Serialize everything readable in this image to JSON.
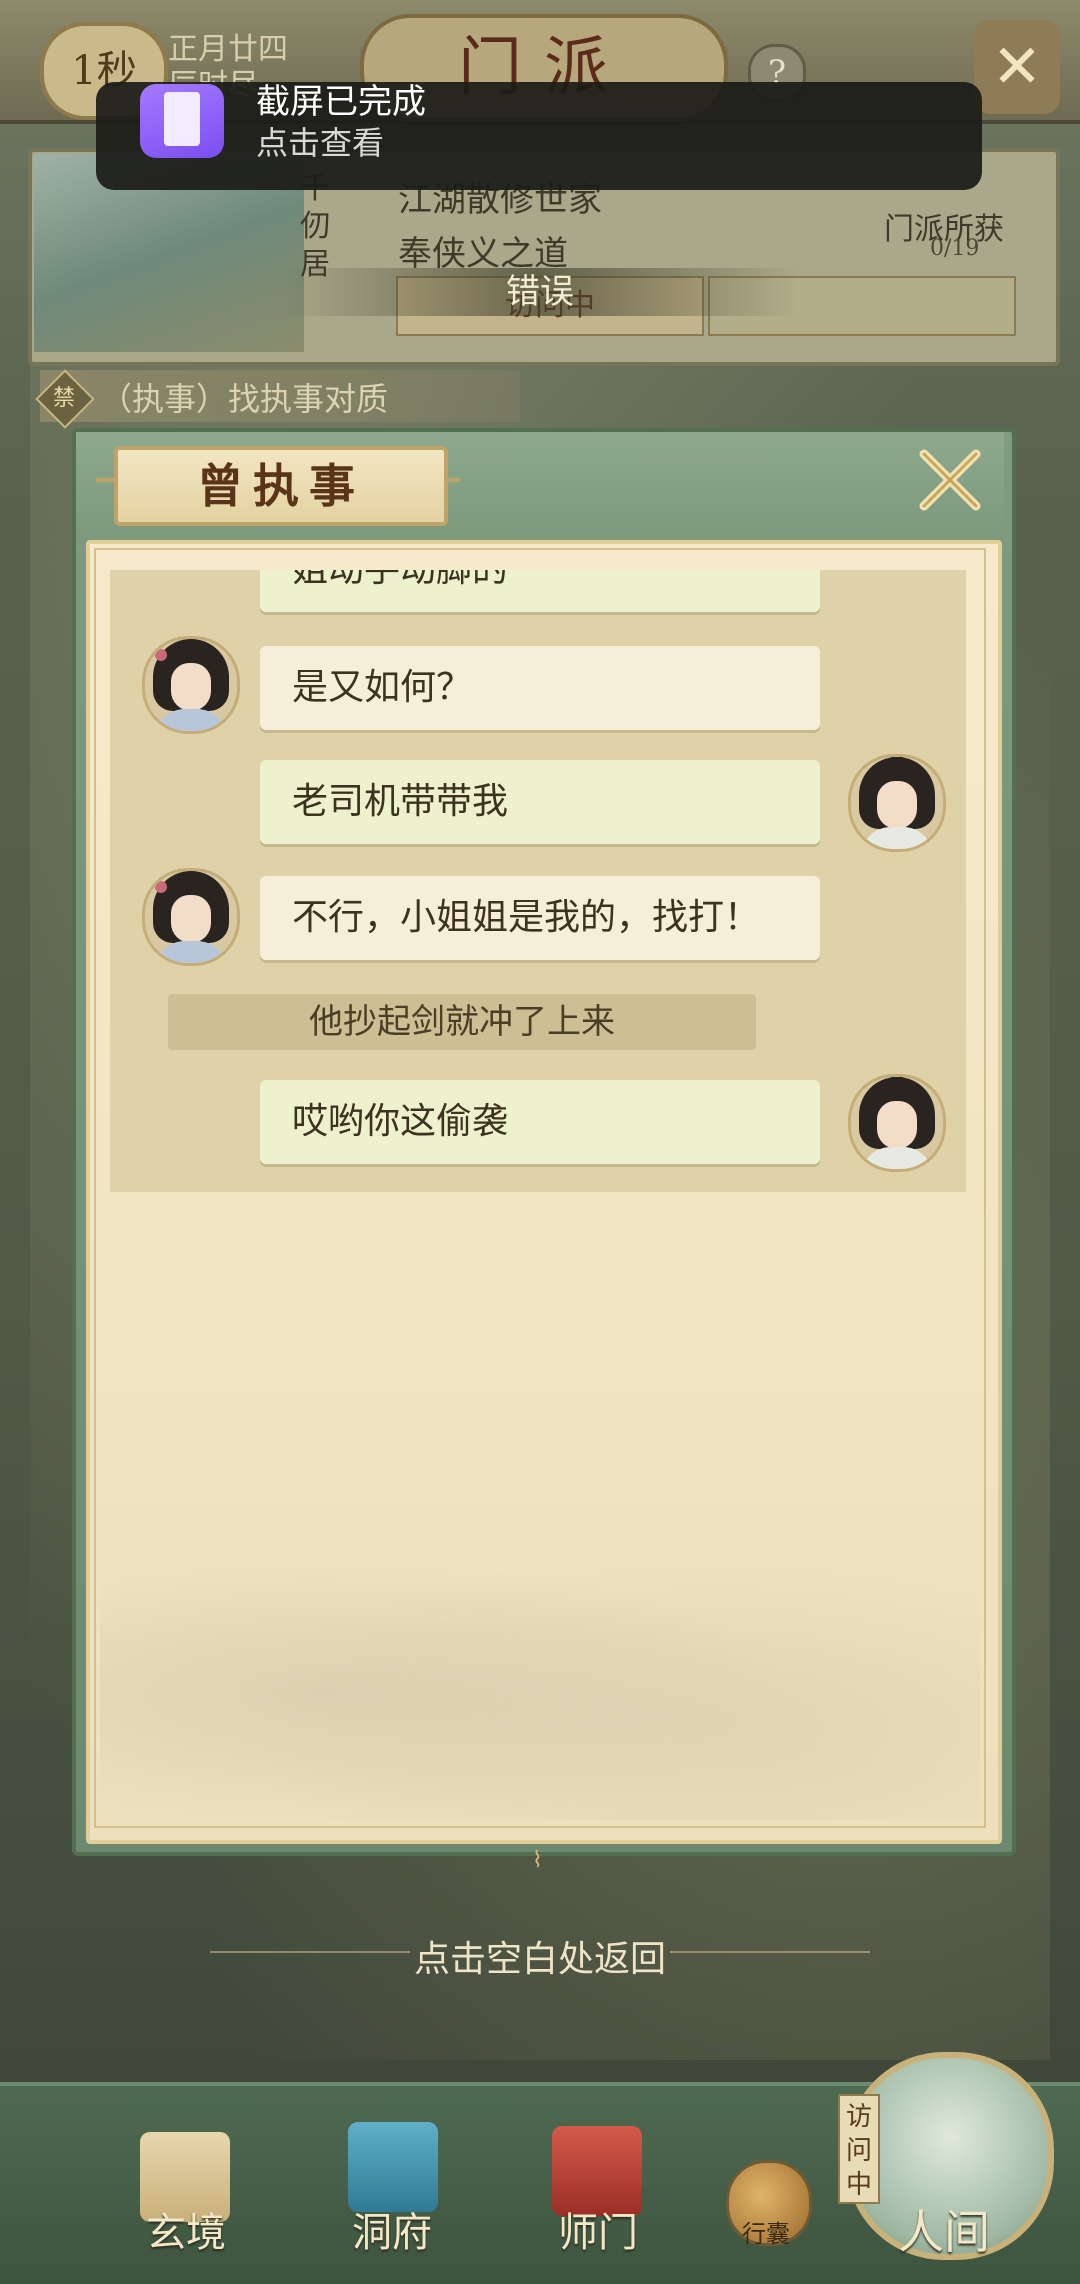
{
  "header": {
    "timer": "1秒",
    "date_line1": "正月廿四",
    "date_line2": "辰时尽",
    "title": "门派",
    "help": "?",
    "close_glyph": "✕"
  },
  "notification": {
    "title": "截屏已完成",
    "subtitle": "点击查看",
    "icon": "gallery-icon"
  },
  "sect": {
    "thumb_vertical": "千仞居",
    "desc_line1": "江湖散修世家",
    "desc_line2": "奉侠义之道",
    "gain_label": "门派所获",
    "gain_count": "0/19",
    "visit_button": "访问中",
    "error_toast": "错误"
  },
  "quest": {
    "icon_text": "禁",
    "text": "（执事）找执事对质"
  },
  "dialog": {
    "title": "曾执事",
    "close_glyph": "✕",
    "partial_top": "姐动手动脚的",
    "messages": [
      {
        "speaker": "female",
        "text": "是又如何？"
      },
      {
        "speaker": "male",
        "text": "老司机带带我"
      },
      {
        "speaker": "female",
        "text": "不行，小姐姐是我的，找打！"
      },
      {
        "speaker": "narration",
        "text": "他抄起剑就冲了上来"
      },
      {
        "speaker": "male",
        "text": "哎哟你这偷袭"
      }
    ],
    "return_hint": "点击空白处返回"
  },
  "nav": {
    "items": [
      {
        "label": "玄境",
        "icon": "scroll-icon"
      },
      {
        "label": "洞府",
        "icon": "pavilion-icon"
      },
      {
        "label": "师门",
        "icon": "banner-icon"
      }
    ],
    "bag_label": "行囊",
    "visit_tag": "访问中",
    "world_label": "人间"
  },
  "colors": {
    "dialog_frame": "#7f9c82",
    "paper": "#f5ebcc",
    "bubble_female": "#f6eed8",
    "bubble_male": "#eef1cd",
    "narration": "#cdbf93"
  }
}
